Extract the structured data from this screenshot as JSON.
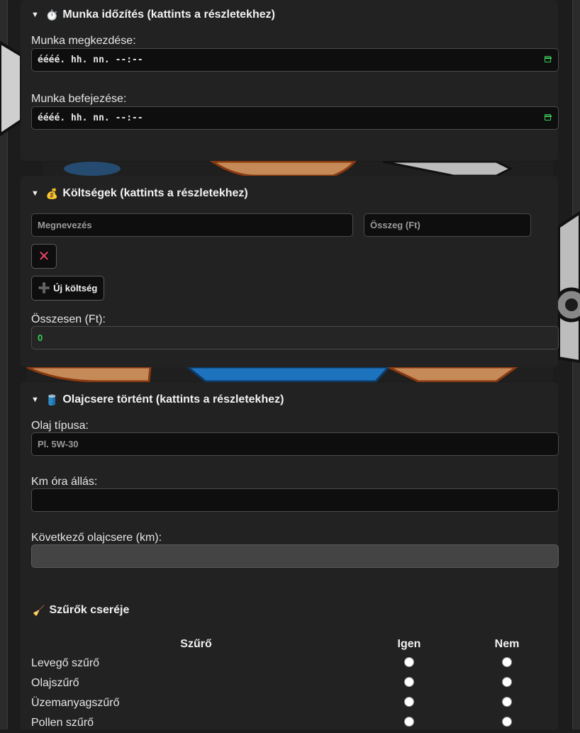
{
  "work_timing": {
    "summary": "Munka időzítés (kattints a részletekhez)",
    "emoji": "⏱️",
    "start_label": "Munka megkezdése:",
    "start_value": "éééé. hh. nn. --:--",
    "end_label": "Munka befejezése:",
    "end_value": "éééé. hh. nn. --:--"
  },
  "costs": {
    "summary": "Költségek (kattints a részletekhez)",
    "emoji": "💰",
    "name_placeholder": "Megnevezés",
    "amount_placeholder": "Összeg (Ft)",
    "remove_icon": "✕",
    "add_button_icon": "➕",
    "add_button_label": "Új költség",
    "total_label": "Összesen (Ft):",
    "total_value": "0"
  },
  "oil": {
    "summary": "Olajcsere történt (kattints a részletekhez)",
    "emoji": "🛢️",
    "type_label": "Olaj típusa:",
    "type_placeholder": "Pl. 5W-30",
    "km_label": "Km óra állás:",
    "next_label": "Következő olajcsere (km):",
    "filters_emoji": "🧹",
    "filters_title": "Szűrők cseréje",
    "filters_headers": [
      "Szűrő",
      "Igen",
      "Nem"
    ],
    "filters": [
      {
        "name": "Levegő szűrő"
      },
      {
        "name": "Olajszűrő"
      },
      {
        "name": "Üzemanyagszűrő"
      },
      {
        "name": "Pollen szűrő"
      }
    ]
  },
  "colors": {
    "accent_green": "#37d04f",
    "remove_red": "#e8466a",
    "add_purple": "#8a6fd6"
  }
}
